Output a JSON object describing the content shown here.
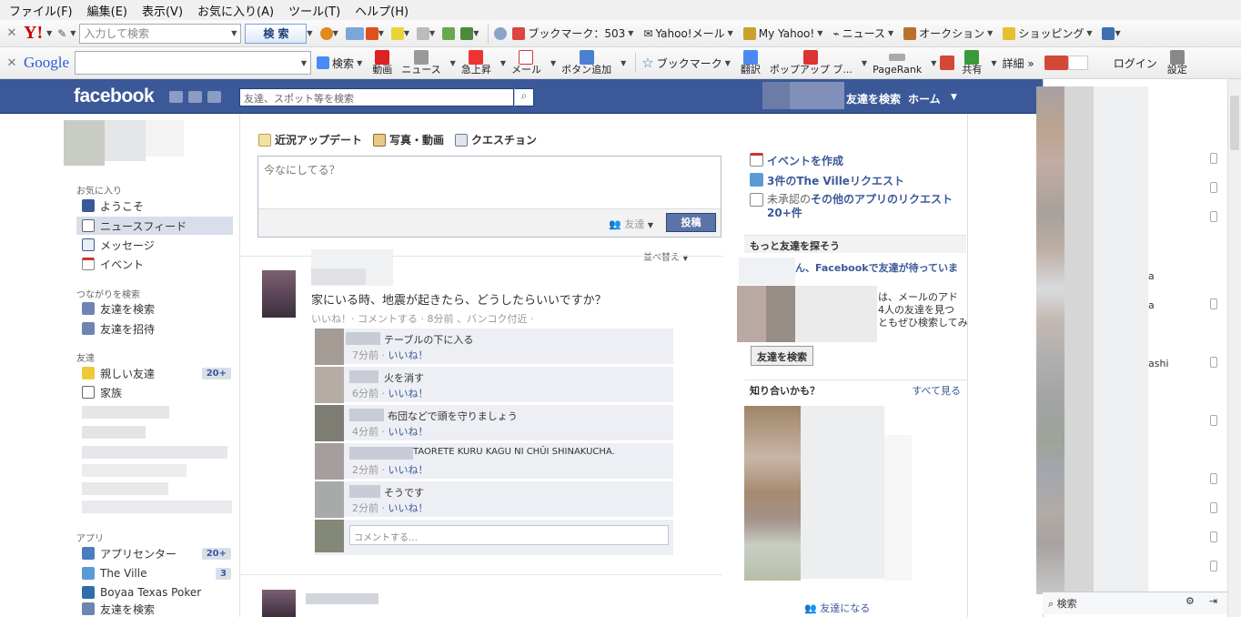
{
  "menu": [
    "ファイル(F)",
    "編集(E)",
    "表示(V)",
    "お気に入り(A)",
    "ツール(T)",
    "ヘルプ(H)"
  ],
  "yahoo_toolbar": {
    "search_placeholder": "入力して検索",
    "search_button": "検 索",
    "bookmarks": "ブックマーク：503",
    "yahoo_mail": "Yahoo!メール",
    "my_yahoo": "My Yahoo!",
    "news": "ニュース",
    "auction": "オークション",
    "shopping": "ショッピング"
  },
  "google_toolbar": {
    "logo": "Google",
    "search": "検索",
    "video": "動画",
    "news": "ニュース",
    "rising": "急上昇",
    "mail": "メール",
    "add_button": "ボタン追加",
    "bookmark": "ブックマーク",
    "translate": "翻訳",
    "popup": "ポップアップ ブ...",
    "pagerank": "PageRank",
    "share": "共有",
    "details": "詳細 »",
    "login": "ログイン",
    "settings": "設定"
  },
  "fb_header": {
    "logo": "facebook",
    "search_placeholder": "友達、スポット等を検索",
    "find_friends": "友達を検索",
    "home": "ホーム"
  },
  "left_nav": {
    "favorites_heading": "お気に入り",
    "favorites": [
      {
        "label": "ようこそ"
      },
      {
        "label": "ニュースフィード"
      },
      {
        "label": "メッセージ"
      },
      {
        "label": "イベント"
      }
    ],
    "connect_heading": "つながりを検索",
    "connect": [
      {
        "label": "友達を検索"
      },
      {
        "label": "友達を招待"
      }
    ],
    "friends_heading": "友達",
    "close_friends": "親しい友達",
    "close_friends_count": "20+",
    "family": "家族",
    "apps_heading": "アプリ",
    "app_center": "アプリセンター",
    "app_center_count": "20+",
    "the_ville": "The Ville",
    "the_ville_count": "3",
    "boyaa": "Boyaa Texas Poker",
    "find_friends": "友達を検索"
  },
  "composer": {
    "tab_status": "近況アップデート",
    "tab_photo": "写真・動画",
    "tab_question": "クエスチョン",
    "placeholder": "今なにしてる？",
    "audience": "友達",
    "post_button": "投稿"
  },
  "feed": {
    "sort": "並べ替え",
    "story_text": "家にいる時、地震が起きたら、どうしたらいいですか？",
    "story_meta": "いいね！· コメントする · 8分前 、バンコク付近 ·",
    "comments": [
      {
        "text": "テーブルの下に入る",
        "time": "7分前",
        "like": "いいね！"
      },
      {
        "text": "火を消す",
        "time": "6分前",
        "like": "いいね！"
      },
      {
        "text": "布団などで頭を守りましょう",
        "time": "4分前",
        "like": "いいね！"
      },
      {
        "text": "TAORETE KURU KAGU NI CHÛI SHINAKUCHA.",
        "time": "2分前",
        "like": "いいね！"
      },
      {
        "text": "そうです",
        "time": "2分前",
        "like": "いいね！"
      }
    ],
    "comment_placeholder": "コメントする…"
  },
  "right_col": {
    "create_event": "イベントを作成",
    "ville_requests": "3件のThe Villeリクエスト",
    "pending_prefix": "未承認の",
    "pending_bold": "その他のアプリのリクエスト20+件",
    "more_friends_heading": "もっと友達を探そう",
    "waiting_text": "ん、Facebookで友達が待っていま",
    "email_line1": "は、メールのアド",
    "email_line2": "4人の友達を見つ",
    "email_line3": "ともぜひ検索してみ",
    "find_friends_button": "友達を検索",
    "pymk_heading": "知り合いかも？",
    "see_all": "すべて見る",
    "add_friend": "友達になる"
  },
  "chat": {
    "names": [
      "a",
      "a",
      "ashi"
    ],
    "search": "検索"
  },
  "colors": {
    "fb_blue": "#3b5998",
    "nav_selected": "#d8dfea",
    "comment_bg": "#edeff4"
  }
}
